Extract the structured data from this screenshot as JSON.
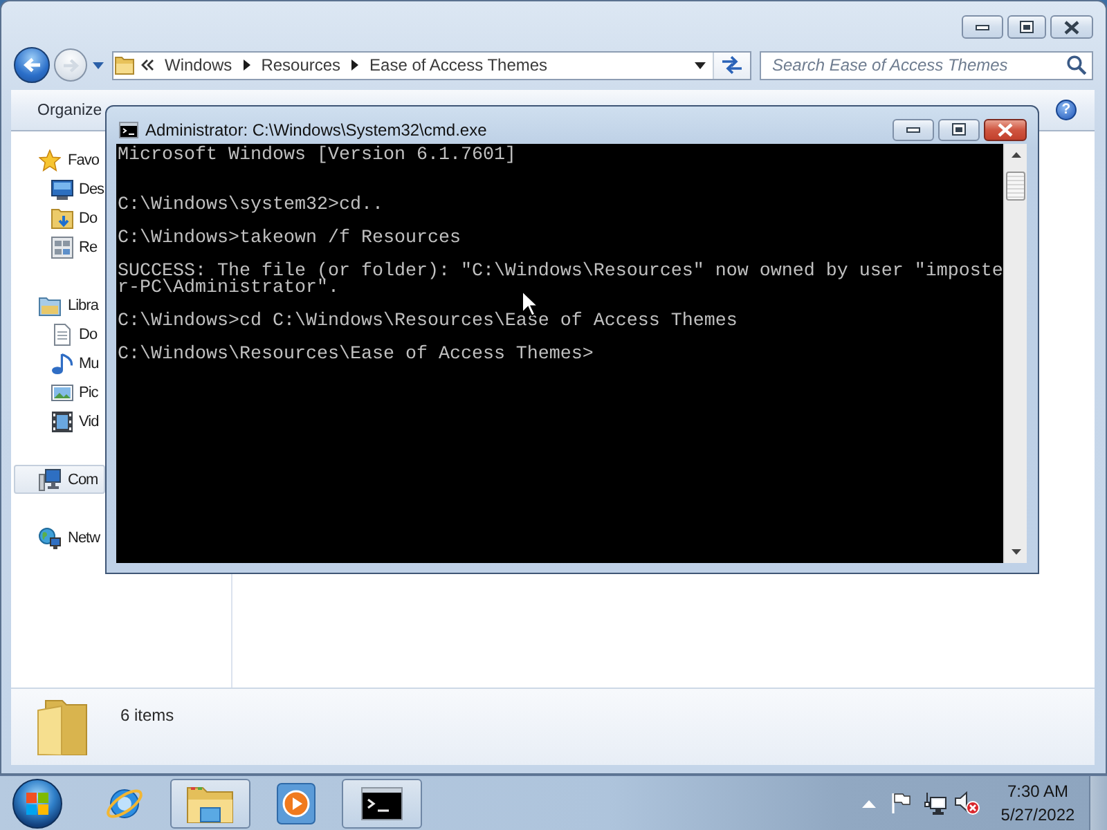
{
  "explorer": {
    "back_button": {
      "disabled": false
    },
    "forward_button": {
      "disabled": true
    },
    "address_bar": {
      "path": [
        "Windows",
        "Resources",
        "Ease of Access Themes"
      ]
    },
    "search": {
      "placeholder": "Search Ease of Access Themes"
    },
    "command_bar": {
      "organize": "Organize",
      "help": "?"
    },
    "navigation": [
      {
        "kind": "favorites",
        "label": "Favo",
        "selected": false,
        "children": [
          {
            "kind": "desktop",
            "label": "Des",
            "selected": false
          },
          {
            "kind": "downloads",
            "label": "Do",
            "selected": false
          },
          {
            "kind": "recent",
            "label": "Re",
            "selected": false
          }
        ]
      },
      {
        "kind": "libraries",
        "label": "Libra",
        "selected": false,
        "children": [
          {
            "kind": "documents",
            "label": "Do",
            "selected": false
          },
          {
            "kind": "music",
            "label": "Mu",
            "selected": false
          },
          {
            "kind": "pictures",
            "label": "Pic",
            "selected": false
          },
          {
            "kind": "videos",
            "label": "Vid",
            "selected": false
          }
        ]
      },
      {
        "kind": "computer",
        "label": "Com",
        "selected": true
      },
      {
        "kind": "network",
        "label": "Netw",
        "selected": false
      }
    ],
    "details": {
      "item_count": "6 items"
    }
  },
  "console_window": {
    "title": "Administrator: C:\\Windows\\System32\\cmd.exe",
    "lines": [
      {
        "kind": "text",
        "text": "Microsoft Windows [Version 6.1.7601]"
      },
      {
        "kind": "blank"
      },
      {
        "kind": "blank"
      },
      {
        "kind": "text",
        "text": "C:\\Windows\\system32>cd.."
      },
      {
        "kind": "blank"
      },
      {
        "kind": "text",
        "text": "C:\\Windows>takeown /f Resources"
      },
      {
        "kind": "blank"
      },
      {
        "kind": "text",
        "text": "SUCCESS: The file (or folder): \"C:\\Windows\\Resources\" now owned by user \"imposte"
      },
      {
        "kind": "text",
        "text": "r-PC\\Administrator\"."
      },
      {
        "kind": "blank"
      },
      {
        "kind": "text",
        "text": "C:\\Windows>cd C:\\Windows\\Resources\\Ease of Access Themes"
      },
      {
        "kind": "blank"
      },
      {
        "kind": "text",
        "text": "C:\\Windows\\Resources\\Ease of Access Themes>"
      }
    ]
  },
  "taskbar": {
    "buttons": [
      {
        "kind": "browser",
        "open": false
      },
      {
        "kind": "folder",
        "open": true
      },
      {
        "kind": "media_player",
        "open": false
      },
      {
        "kind": "console",
        "open": true
      }
    ],
    "tray": {
      "volume_muted": true
    },
    "clock": {
      "time": "7:30 AM",
      "date": "5/27/2022"
    }
  }
}
